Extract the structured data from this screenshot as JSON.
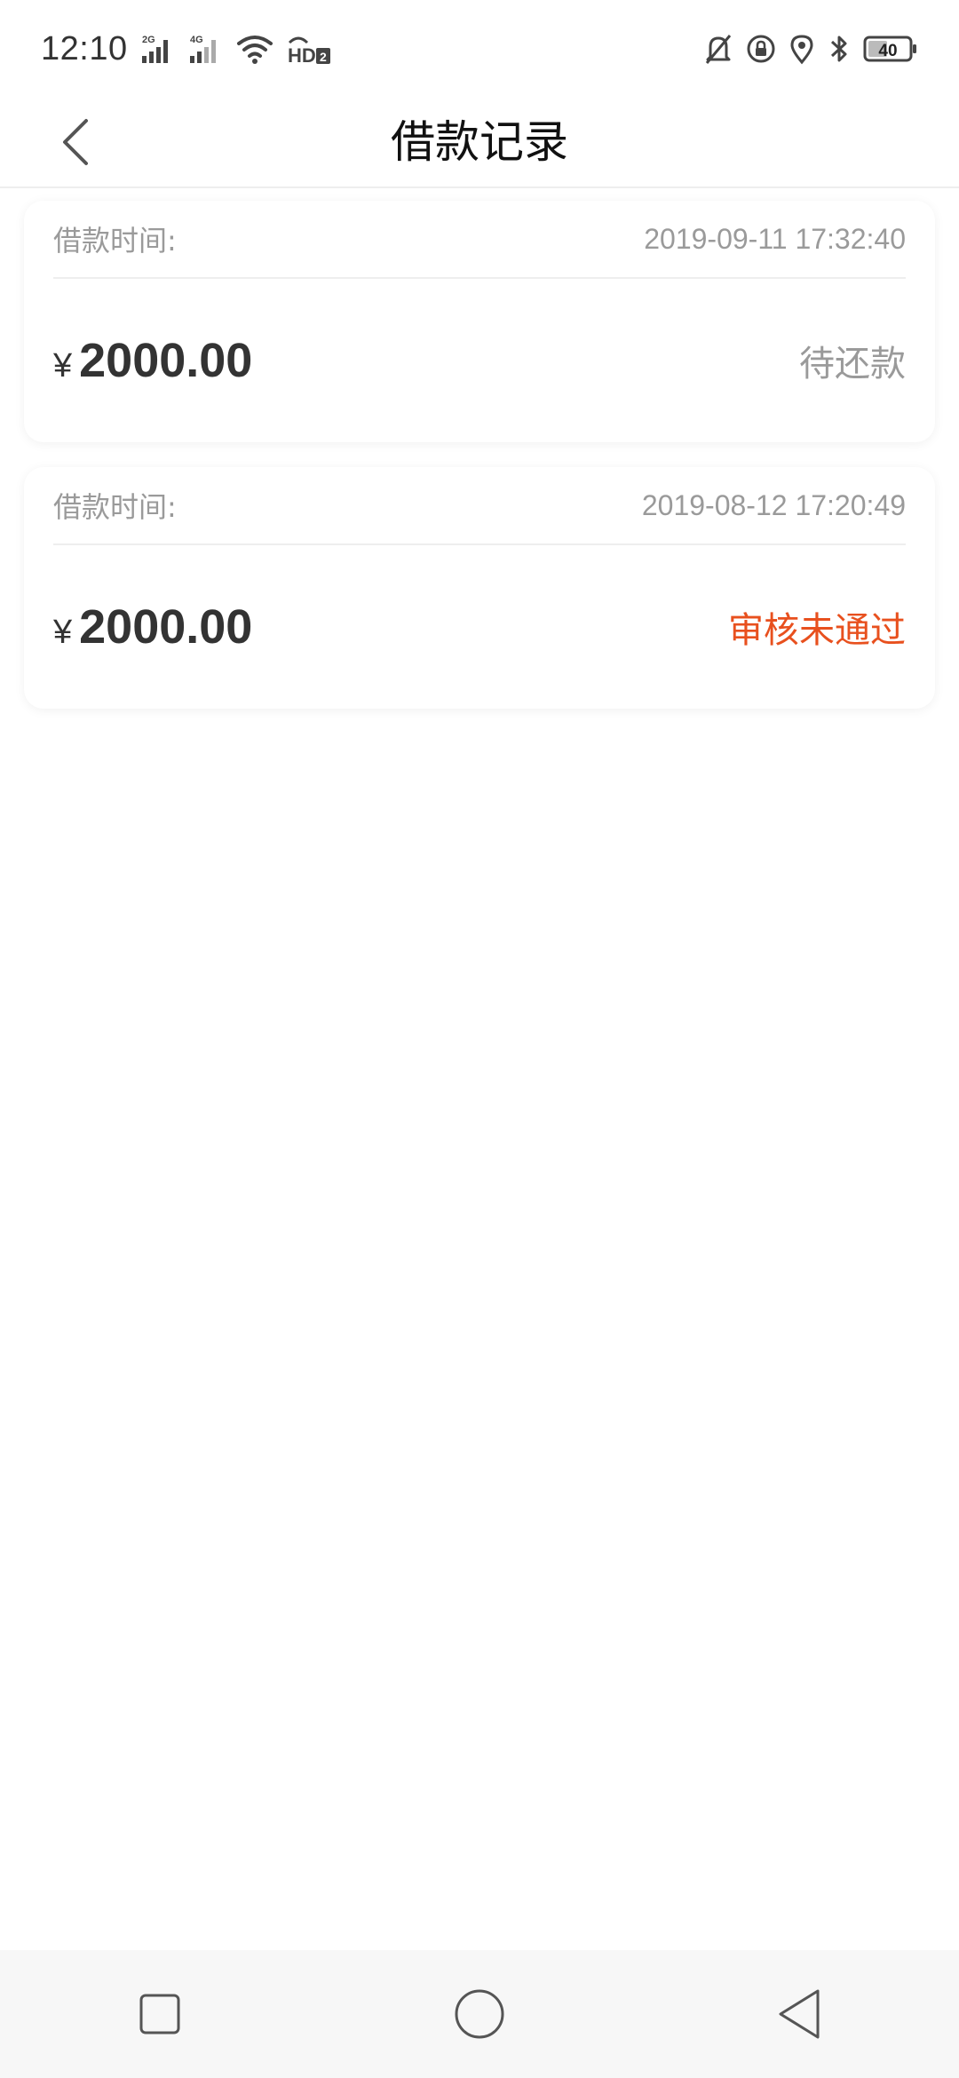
{
  "status_bar": {
    "time": "12:10",
    "network_1": "2G",
    "network_2": "4G",
    "hd_label": "HD",
    "hd_sub": "2",
    "battery": "40",
    "icons": [
      "signal-icon",
      "wifi-icon",
      "alarm-off-icon",
      "rotation-lock-icon",
      "location-icon",
      "bluetooth-icon",
      "battery-icon"
    ]
  },
  "header": {
    "title": "借款记录",
    "back_icon": "chevron-left-icon"
  },
  "records": [
    {
      "time_label": "借款时间:",
      "time_value": "2019-09-11 17:32:40",
      "currency": "¥",
      "amount": "2000.00",
      "status": "待还款",
      "status_color": "#9a9a9a"
    },
    {
      "time_label": "借款时间:",
      "time_value": "2019-08-12 17:20:49",
      "currency": "¥",
      "amount": "2000.00",
      "status": "审核未通过",
      "status_color": "#e8501e"
    }
  ],
  "nav_bar": {
    "icons": [
      "recent-apps-icon",
      "home-icon",
      "back-icon"
    ]
  }
}
